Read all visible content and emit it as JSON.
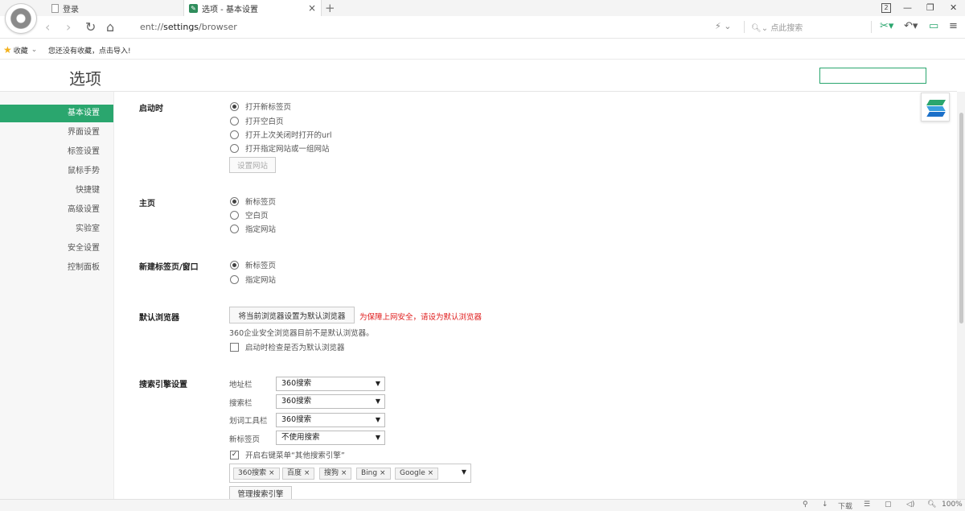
{
  "tabs": [
    {
      "label": "登录"
    },
    {
      "label": "选项 - 基本设置"
    }
  ],
  "new_tab_glyph": "+",
  "window_controls": {
    "badge": "2",
    "minimize": "—",
    "restore": "❐",
    "close": "✕"
  },
  "nav": {
    "back": "‹",
    "forward": "›",
    "reload": "↻",
    "home": "⌂"
  },
  "address": {
    "scheme": "ent://",
    "path": "settings",
    "suffix": "/browser"
  },
  "toolbar_search": {
    "placeholder": "点此搜索",
    "lightning": "⚡ ⌄"
  },
  "toolbar_tools": {
    "scissors": "✂▾",
    "undo": "↶▾",
    "chat": "▭",
    "menu": "≡"
  },
  "bookmarks": {
    "favorites_label": "收藏",
    "empty_note": "您还没有收藏，点击导入!"
  },
  "page_title": "选项",
  "sidebar": {
    "items": [
      {
        "label": "基本设置",
        "active": true
      },
      {
        "label": "界面设置"
      },
      {
        "label": "标签设置"
      },
      {
        "label": "鼠标手势"
      },
      {
        "label": "快捷键"
      },
      {
        "label": "高级设置"
      },
      {
        "label": "实验室"
      },
      {
        "label": "安全设置"
      },
      {
        "label": "控制面板"
      }
    ]
  },
  "startup": {
    "label": "启动时",
    "options": [
      "打开新标签页",
      "打开空白页",
      "打开上次关闭时打开的url",
      "打开指定网站或一组网站"
    ],
    "selected": 0,
    "set_sites_button": "设置网站"
  },
  "homepage": {
    "label": "主页",
    "options": [
      "新标签页",
      "空白页",
      "指定网站"
    ],
    "selected": 0
  },
  "newtab": {
    "label": "新建标签页/窗口",
    "options": [
      "新标签页",
      "指定网站"
    ],
    "selected": 0
  },
  "default_browser": {
    "label": "默认浏览器",
    "set_button": "将当前浏览器设置为默认浏览器",
    "warning": "为保障上网安全，请设为默认浏览器",
    "status": "360企业安全浏览器目前不是默认浏览器。",
    "check_label": "启动时检查是否为默认浏览器"
  },
  "search_engine": {
    "label": "搜索引擎设置",
    "rows": [
      {
        "label": "地址栏",
        "value": "360搜索"
      },
      {
        "label": "搜索栏",
        "value": "360搜索"
      },
      {
        "label": "划词工具栏",
        "value": "360搜索"
      },
      {
        "label": "新标签页",
        "value": "不使用搜索"
      }
    ],
    "context_menu_label": "开启右键菜单“其他搜索引擎”",
    "chips": [
      "360搜索 ×",
      "百度 ×",
      "搜狗 ×",
      "Bing ×",
      "Google ×"
    ],
    "manage_button": "管理搜索引擎"
  },
  "statusbar": {
    "download": "下载",
    "zoom": "100%"
  }
}
